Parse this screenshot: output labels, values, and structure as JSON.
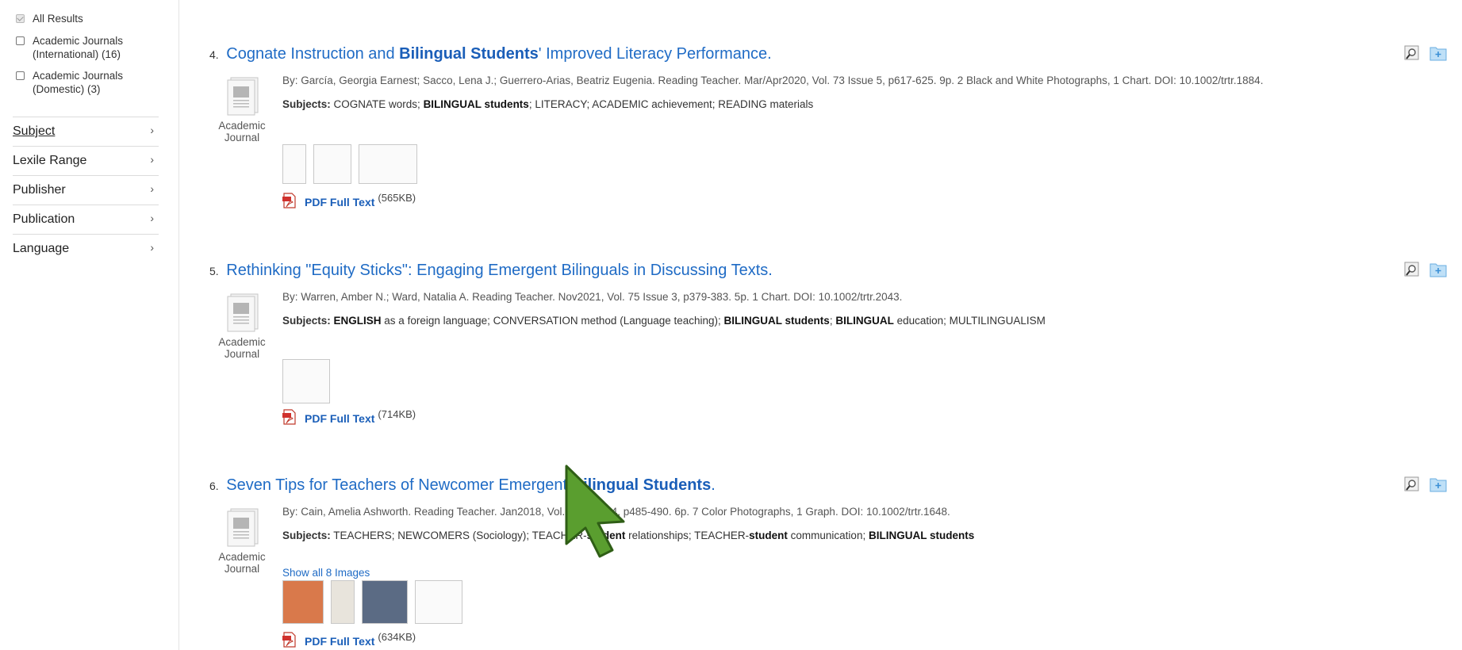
{
  "sidebar": {
    "sources": [
      {
        "label": "All Results",
        "checked": true
      },
      {
        "label": "Academic Journals\n(International) (16)",
        "checked": false
      },
      {
        "label": "Academic Journals\n(Domestic) (3)",
        "checked": false
      }
    ],
    "facets": [
      {
        "label": "Subject",
        "active": true
      },
      {
        "label": "Lexile Range"
      },
      {
        "label": "Publisher"
      },
      {
        "label": "Publication"
      },
      {
        "label": "Language"
      }
    ],
    "chevron": "›"
  },
  "results": [
    {
      "number": "4.",
      "title_html": "Cognate Instruction and <b>Bilingual Students</b>' Improved Literacy Performance.",
      "type": "Academic Journal",
      "by": "By: García, Georgia Earnest; Sacco, Lena J.; Guerrero-Arias, Beatriz Eugenia. Reading Teacher. Mar/Apr2020, Vol. 73 Issue 5, p617-625. 9p. 2 Black and White Photographs, 1 Chart. DOI: 10.1002/trtr.1884.",
      "subjects_label": "Subjects:",
      "subjects_html": "COGNATE words; <b>BILINGUAL students</b>; LITERACY; ACADEMIC achievement; READING materials",
      "pdf_label": "PDF Full Text",
      "pdf_size": "(565KB)"
    },
    {
      "number": "5.",
      "title_html": "Rethinking \"Equity Sticks\": Engaging Emergent Bilinguals in Discussing Texts.",
      "type": "Academic Journal",
      "by": "By: Warren, Amber N.; Ward, Natalia A. Reading Teacher. Nov2021, Vol. 75 Issue 3, p379-383. 5p. 1 Chart. DOI: 10.1002/trtr.2043.",
      "subjects_label": "Subjects:",
      "subjects_html": "<b>ENGLISH</b> as a foreign language; CONVERSATION method (Language teaching); <b>BILINGUAL students</b>; <b>BILINGUAL</b> education; MULTILINGUALISM",
      "pdf_label": "PDF Full Text",
      "pdf_size": "(714KB)"
    },
    {
      "number": "6.",
      "title_html": "Seven Tips for Teachers of Newcomer Emergent <b>Bilingual Students</b>.",
      "type": "Academic Journal",
      "by": "By: Cain, Amelia Ashworth. Reading Teacher. Jan2018, Vol. 71 Issue 4, p485-490. 6p. 7 Color Photographs, 1 Graph. DOI: 10.1002/trtr.1648.",
      "subjects_label": "Subjects:",
      "subjects_html": "TEACHERS; NEWCOMERS (Sociology); TEACHER-<b>student</b> relationships; TEACHER-<b>student</b> communication; <b>BILINGUAL students</b>",
      "show_images": "Show all 8 Images",
      "pdf_label": "PDF Full Text",
      "pdf_size": "(634KB)"
    }
  ],
  "icons": {
    "doc": "document-icon",
    "pdf": "pdf-icon",
    "preview": "preview-magnifier-icon",
    "folder": "add-to-folder-icon",
    "cursor": "mouse-cursor-icon"
  },
  "colors": {
    "link": "#1f6bc5",
    "cursor": "#5a9e2f"
  }
}
